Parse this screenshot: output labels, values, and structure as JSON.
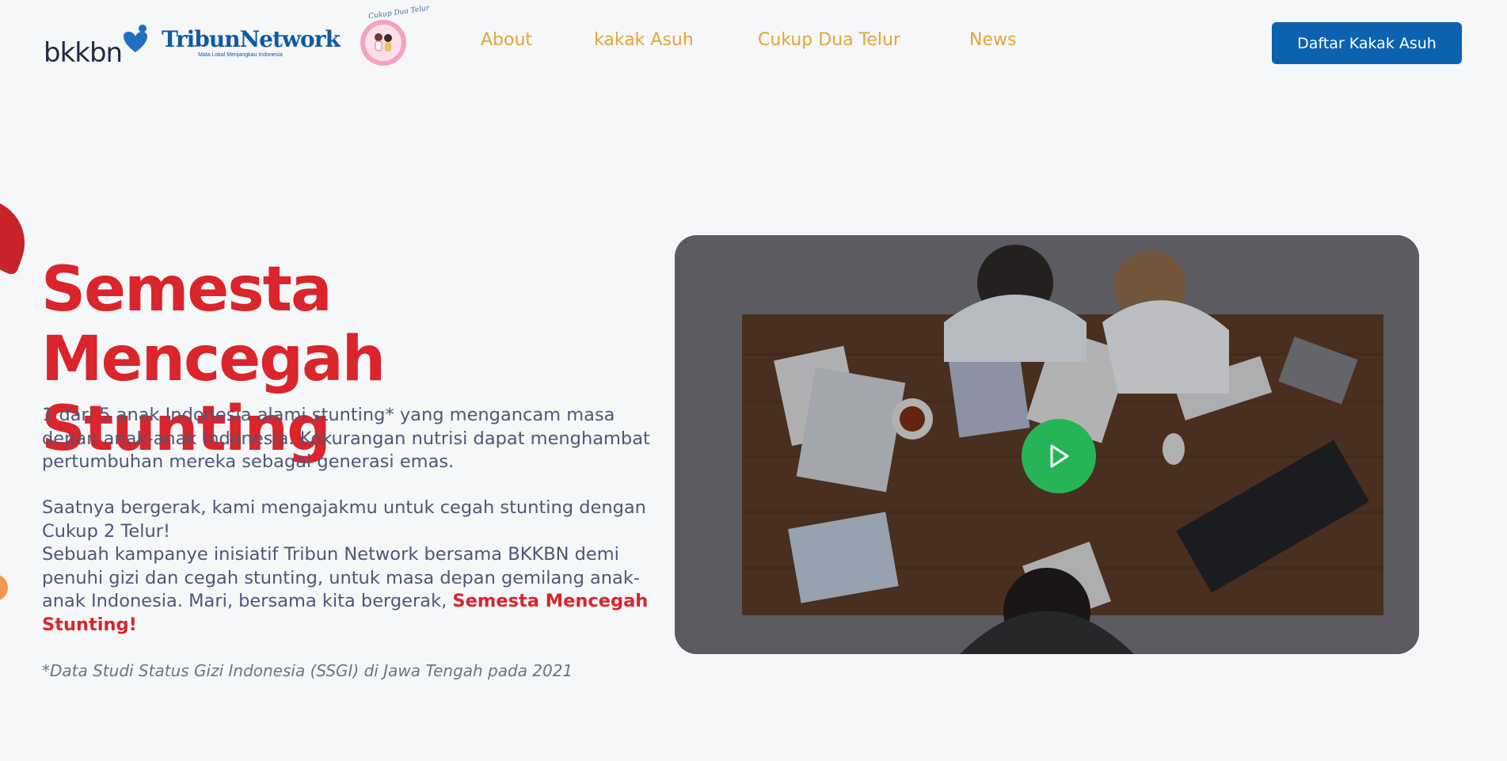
{
  "header": {
    "logos": {
      "bkkbn": "bkkbn",
      "tribun": "TribunNetwork",
      "tribun_tagline": "Mata Lokal Menjangkau Indonesia",
      "badge_text": "Cukup Dua Telur"
    },
    "nav": [
      {
        "label": "About"
      },
      {
        "label": "kakak Asuh"
      },
      {
        "label": "Cukup Dua Telur"
      },
      {
        "label": "News"
      }
    ],
    "cta_label": "Daftar Kakak Asuh"
  },
  "hero": {
    "title": "Semesta Mencegah Stunting",
    "paragraph1": "1 dari 5 anak Indonesia alami stunting* yang mengancam masa depan anak-anak Indonesia. Kekurangan nutrisi dapat menghambat pertumbuhan mereka sebagai generasi emas.",
    "paragraph2_line1": "Saatnya bergerak, kami mengajakmu untuk cegah stunting dengan Cukup 2 Telur!",
    "paragraph2_line2": "Sebuah kampanye inisiatif Tribun Network bersama BKKBN demi penuhi gizi dan cegah stunting, untuk masa depan gemilang anak-anak Indonesia. Mari, bersama kita bergerak, ",
    "paragraph2_highlight": "Semesta Mencegah Stunting!",
    "footnote": "*Data Studi Status Gizi Indonesia (SSGI) di Jawa Tengah pada 2021"
  },
  "video": {
    "icon": "play-icon"
  },
  "colors": {
    "accent_red": "#d9252b",
    "nav_gold": "#e2a53a",
    "cta_blue": "#0b63b0",
    "play_green": "#27b457",
    "body_text": "#4d5878"
  }
}
